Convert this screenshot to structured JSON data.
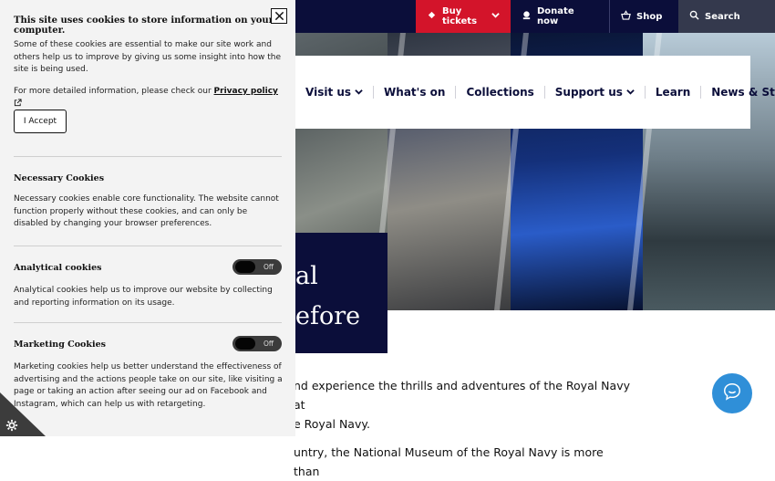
{
  "topbar": {
    "buy_tickets": "Buy tickets",
    "donate": "Donate now",
    "shop": "Shop",
    "search": "Search"
  },
  "nav": {
    "items": [
      {
        "label": "Visit us",
        "dropdown": true
      },
      {
        "label": "What's on",
        "dropdown": false
      },
      {
        "label": "Collections",
        "dropdown": false
      },
      {
        "label": "Support us",
        "dropdown": true
      },
      {
        "label": "Learn",
        "dropdown": false
      },
      {
        "label": "News & Stories",
        "dropdown": false
      }
    ]
  },
  "hero": {
    "title_line1": "al",
    "title_line2": "efore"
  },
  "body": {
    "line1": "nd experience the thrills and adventures of the Royal Navy at",
    "line2": "e Royal Navy.",
    "line3": "untry, the National Museum of the Royal Navy is more than"
  },
  "cookie_banner": {
    "title": "This site uses cookies to store information on your computer.",
    "intro": "Some of these cookies are essential to make our site work and others help us to improve by giving us some insight into how the site is being used.",
    "more_info_prefix": "For more detailed information, please check our",
    "privacy_link": "Privacy policy",
    "accept": "I Accept",
    "necessary_title": "Necessary Cookies",
    "necessary_text": "Necessary cookies enable core functionality. The website cannot function properly without these cookies, and can only be disabled by changing your browser preferences.",
    "analytical_title": "Analytical cookies",
    "analytical_toggle": "Off",
    "analytical_text": "Analytical cookies help us to improve our website by collecting and reporting information on its usage.",
    "marketing_title": "Marketing Cookies",
    "marketing_toggle": "Off",
    "marketing_text": "Marketing cookies help us better understand the effectiveness of advertising and the actions people take on our site, like visiting a page or taking an action after seeing our ad on Facebook and Instagram, which can help us with retargeting."
  },
  "colors": {
    "navy": "#0b0e3a",
    "red": "#d3142a",
    "chat_blue": "#2f8fd8"
  }
}
